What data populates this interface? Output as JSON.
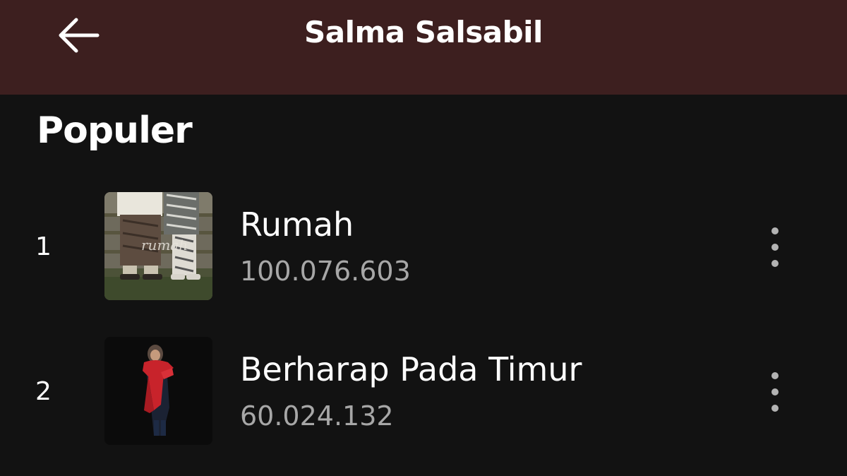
{
  "header": {
    "title": "Salma Salsabil",
    "back_icon": "arrow-left-icon"
  },
  "section": {
    "title": "Populer"
  },
  "tracks": [
    {
      "rank": "1",
      "title": "Rumah",
      "plays": "100.076.603",
      "cover_text": "rumah",
      "more_icon": "more-vertical-icon"
    },
    {
      "rank": "2",
      "title": "Berharap Pada Timur",
      "plays": "60.024.132",
      "more_icon": "more-vertical-icon"
    }
  ],
  "colors": {
    "header_bg": "#3d1f1f",
    "page_bg": "#121212",
    "text_primary": "#ffffff",
    "text_secondary": "#a7a7a7",
    "accent_red": "#c8232b"
  }
}
